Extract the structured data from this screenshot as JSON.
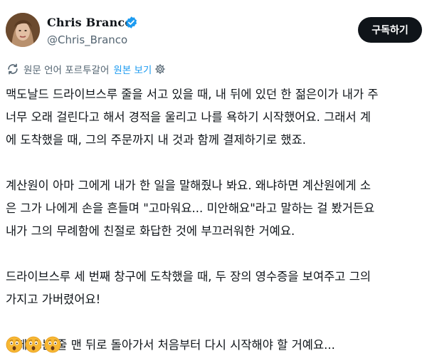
{
  "author": {
    "display_name": "Chris Branco",
    "handle": "@Chris_Branco",
    "verified": true
  },
  "subscribe_label": "구독하기",
  "translation": {
    "notice": "원문 언어 포르투갈어",
    "show_original": "원본 보기"
  },
  "tweet": {
    "p1": [
      "맥도날드 드라이브스루 줄을 서고 있을 때, 내 뒤에 있던 한 젊은이가 내가 주",
      "너무 오래 걸린다고 해서 경적을 울리고 나를 욕하기 시작했어요. 그래서 계",
      "에 도착했을 때, 그의 주문까지 내 것과 함께 결제하기로 했죠."
    ],
    "p2": [
      "계산원이 아마 그에게 내가 한 일을 말해줬나 봐요. 왜냐하면 계산원에게 소",
      "은 그가 나에게 손을 흔들며 \"고마워요... 미안해요\"라고 말하는 걸 봤거든요",
      "내가 그의 무례함에 친절로 화답한 것에 부끄러워한 거예요."
    ],
    "p3": [
      "드라이브스루 세 번째 창구에 도착했을 때, 두 장의 영수증을 보여주고 그의",
      "가지고 가버렸어요!"
    ],
    "p4": [
      "이제 그는 줄 맨 뒤로 돌아가서 처음부터 다시 시작해야 할 거예요..."
    ],
    "emojis": [
      "astonished-face",
      "astonished-face",
      "astonished-face"
    ]
  },
  "colors": {
    "button_bg": "#0f1419",
    "link_blue": "#1d9bf0",
    "muted": "#536471",
    "verified_blue": "#1d9bf0"
  }
}
